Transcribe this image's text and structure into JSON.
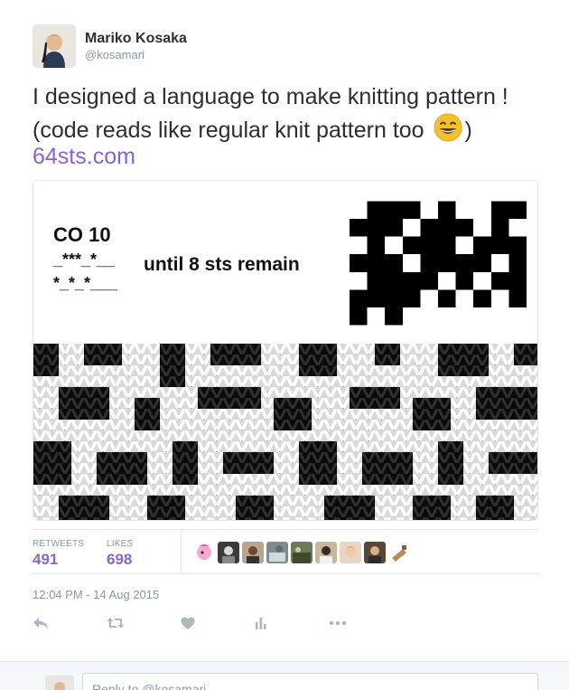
{
  "author": {
    "name": "Mariko Kosaka",
    "handle": "@kosamari"
  },
  "tweet": {
    "text_line1": "I designed a language to make knitting pattern !",
    "text_line2_before": "(code reads like regular knit pattern too",
    "text_line2_after": ")",
    "emoji": "grinning-face-emoji",
    "link": "64sts.com"
  },
  "media": {
    "code_line1": "CO 10",
    "pattern_row1": "_***_*__",
    "pattern_row2": "*_*_*___",
    "until_text": "until 8 sts remain"
  },
  "stats": {
    "retweets_label": "RETWEETS",
    "retweets_count": "491",
    "likes_label": "LIKES",
    "likes_count": "698",
    "liker_avatars": [
      "pony-avatar",
      "person-avatar",
      "person-avatar",
      "photo-avatar",
      "photo-avatar",
      "person-avatar",
      "person-avatar",
      "person-avatar",
      "tool-avatar"
    ]
  },
  "timestamp": "12:04 PM - 14 Aug 2015",
  "actions": [
    "reply-icon",
    "retweet-icon",
    "like-icon",
    "analytics-icon",
    "more-icon"
  ],
  "reply": {
    "placeholder": "Reply to @kosamari"
  },
  "colors": {
    "accent": "#8a65c9",
    "muted": "#8899a6",
    "text": "#292f33"
  }
}
